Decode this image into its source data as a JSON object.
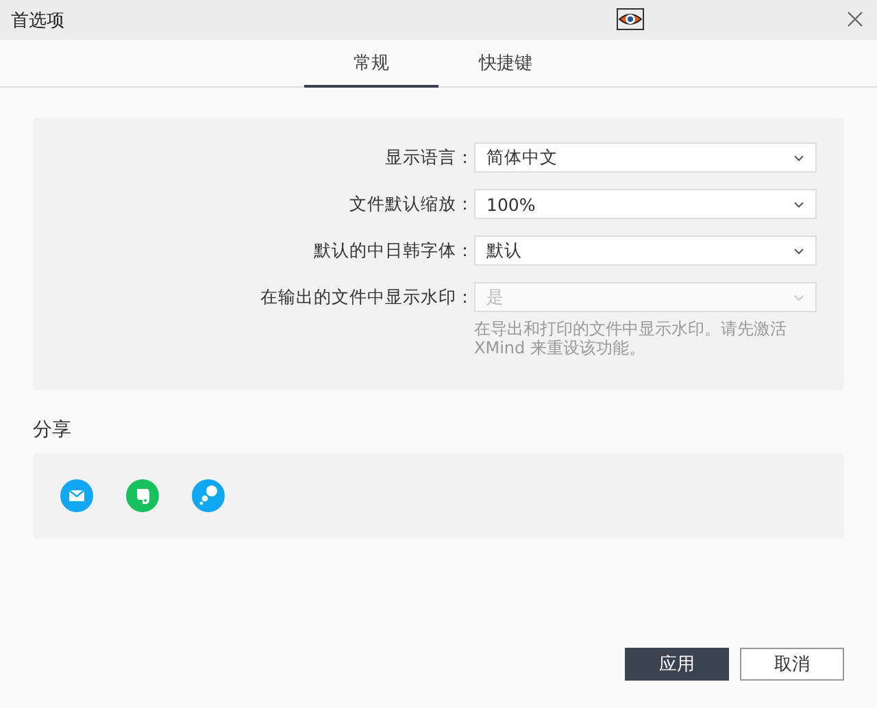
{
  "window": {
    "title": "首选项"
  },
  "tabs": [
    {
      "label": "常规",
      "selected": true
    },
    {
      "label": "快捷键",
      "selected": false
    }
  ],
  "settings": [
    {
      "label": "显示语言：",
      "value": "简体中文",
      "disabled": false
    },
    {
      "label": "文件默认缩放：",
      "value": "100%",
      "disabled": false
    },
    {
      "label": "默认的中日韩字体：",
      "value": "默认",
      "disabled": false
    },
    {
      "label": "在输出的文件中显示水印：",
      "value": "是",
      "disabled": true,
      "note": "在导出和打印的文件中显示水印。请先激活 XMind 来重设该功能。"
    }
  ],
  "share": {
    "title": "分享",
    "items": [
      {
        "kind": "mail"
      },
      {
        "kind": "evernote"
      },
      {
        "kind": "bubbles"
      }
    ]
  },
  "buttons": [
    {
      "label": "应用",
      "kind": "primary"
    },
    {
      "label": "取消",
      "kind": "secondary"
    }
  ]
}
